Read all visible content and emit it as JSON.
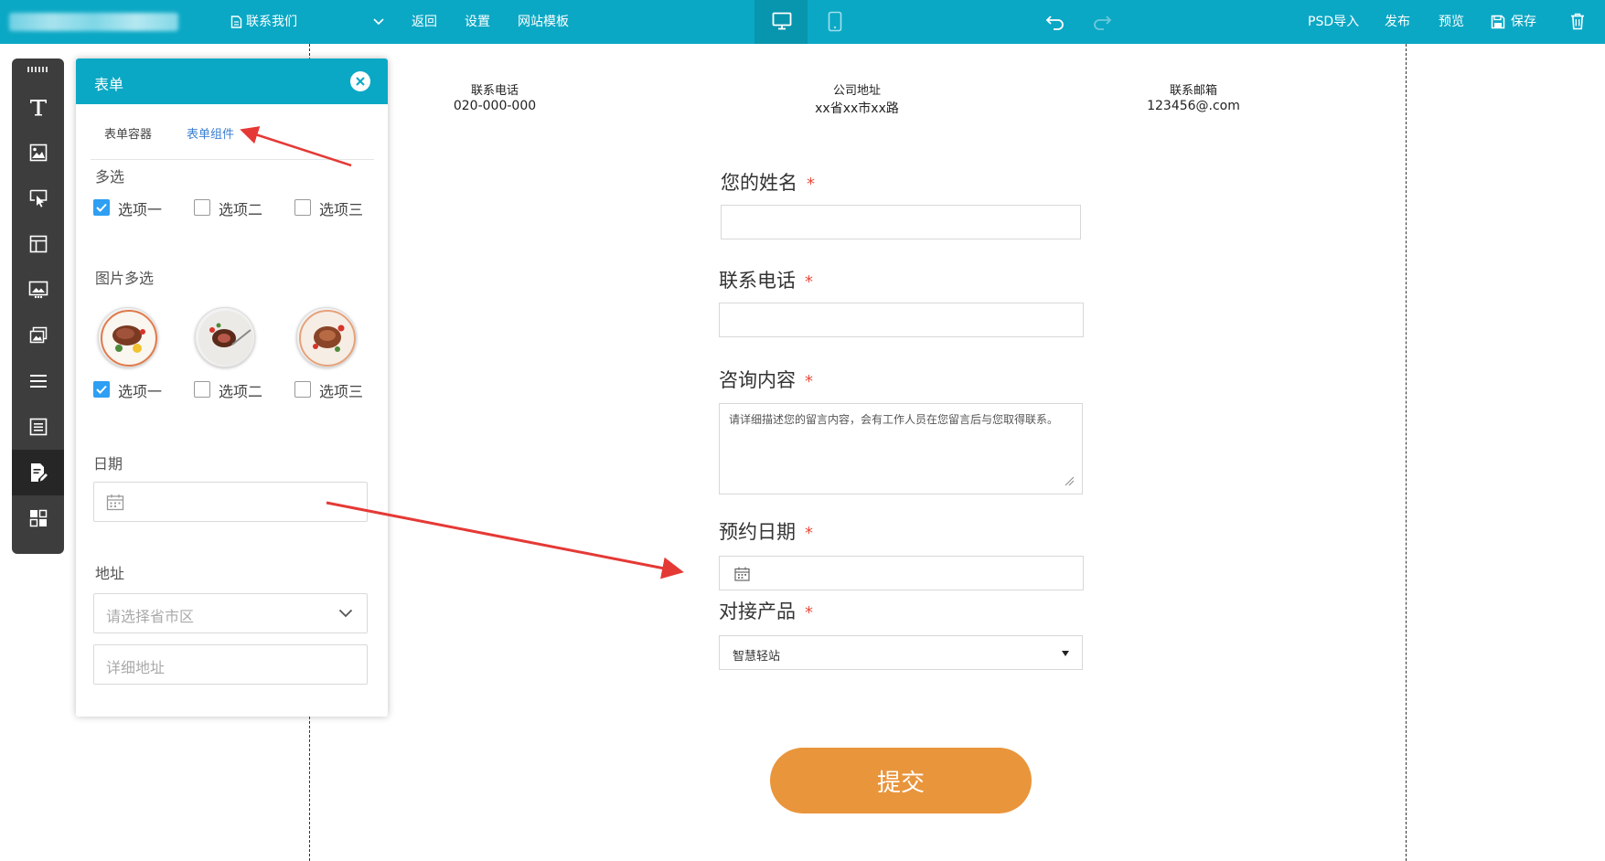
{
  "topbar": {
    "page_name": "联系我们",
    "back": "返回",
    "settings": "设置",
    "templates": "网站模板",
    "psd_import": "PSD导入",
    "publish": "发布",
    "preview": "预览",
    "save": "保存"
  },
  "panel": {
    "title": "表单",
    "tabs": [
      "表单容器",
      "表单组件"
    ],
    "active_tab": "表单组件",
    "multi_select": {
      "label": "多选",
      "options": [
        {
          "label": "选项一",
          "checked": true
        },
        {
          "label": "选项二",
          "checked": false
        },
        {
          "label": "选项三",
          "checked": false
        }
      ]
    },
    "image_multi_select": {
      "label": "图片多选",
      "options": [
        {
          "label": "选项一",
          "checked": true
        },
        {
          "label": "选项二",
          "checked": false
        },
        {
          "label": "选项三",
          "checked": false
        }
      ]
    },
    "date_label": "日期",
    "address": {
      "label": "地址",
      "region_placeholder": "请选择省市区",
      "detail_placeholder": "详细地址"
    }
  },
  "contact_info": [
    {
      "label": "联系电话",
      "value": "020-000-000"
    },
    {
      "label": "公司地址",
      "value": "xx省xx市xx路"
    },
    {
      "label": "联系邮箱",
      "value": "123456@.com"
    }
  ],
  "form": {
    "name_label": "您的姓名",
    "phone_label": "联系电话",
    "inquiry_label": "咨询内容",
    "inquiry_placeholder": "请详细描述您的留言内容，会有工作人员在您留言后与您取得联系。",
    "date_label": "预约日期",
    "product_label": "对接产品",
    "product_value": "智慧轻站",
    "required_mark": "*",
    "submit": "提交"
  },
  "colors": {
    "topbar": "#0ba8c5",
    "accent_blue": "#2e9ff3",
    "required": "#e84c3d",
    "submit": "#e9953c",
    "annotation_arrow": "#e53935"
  }
}
